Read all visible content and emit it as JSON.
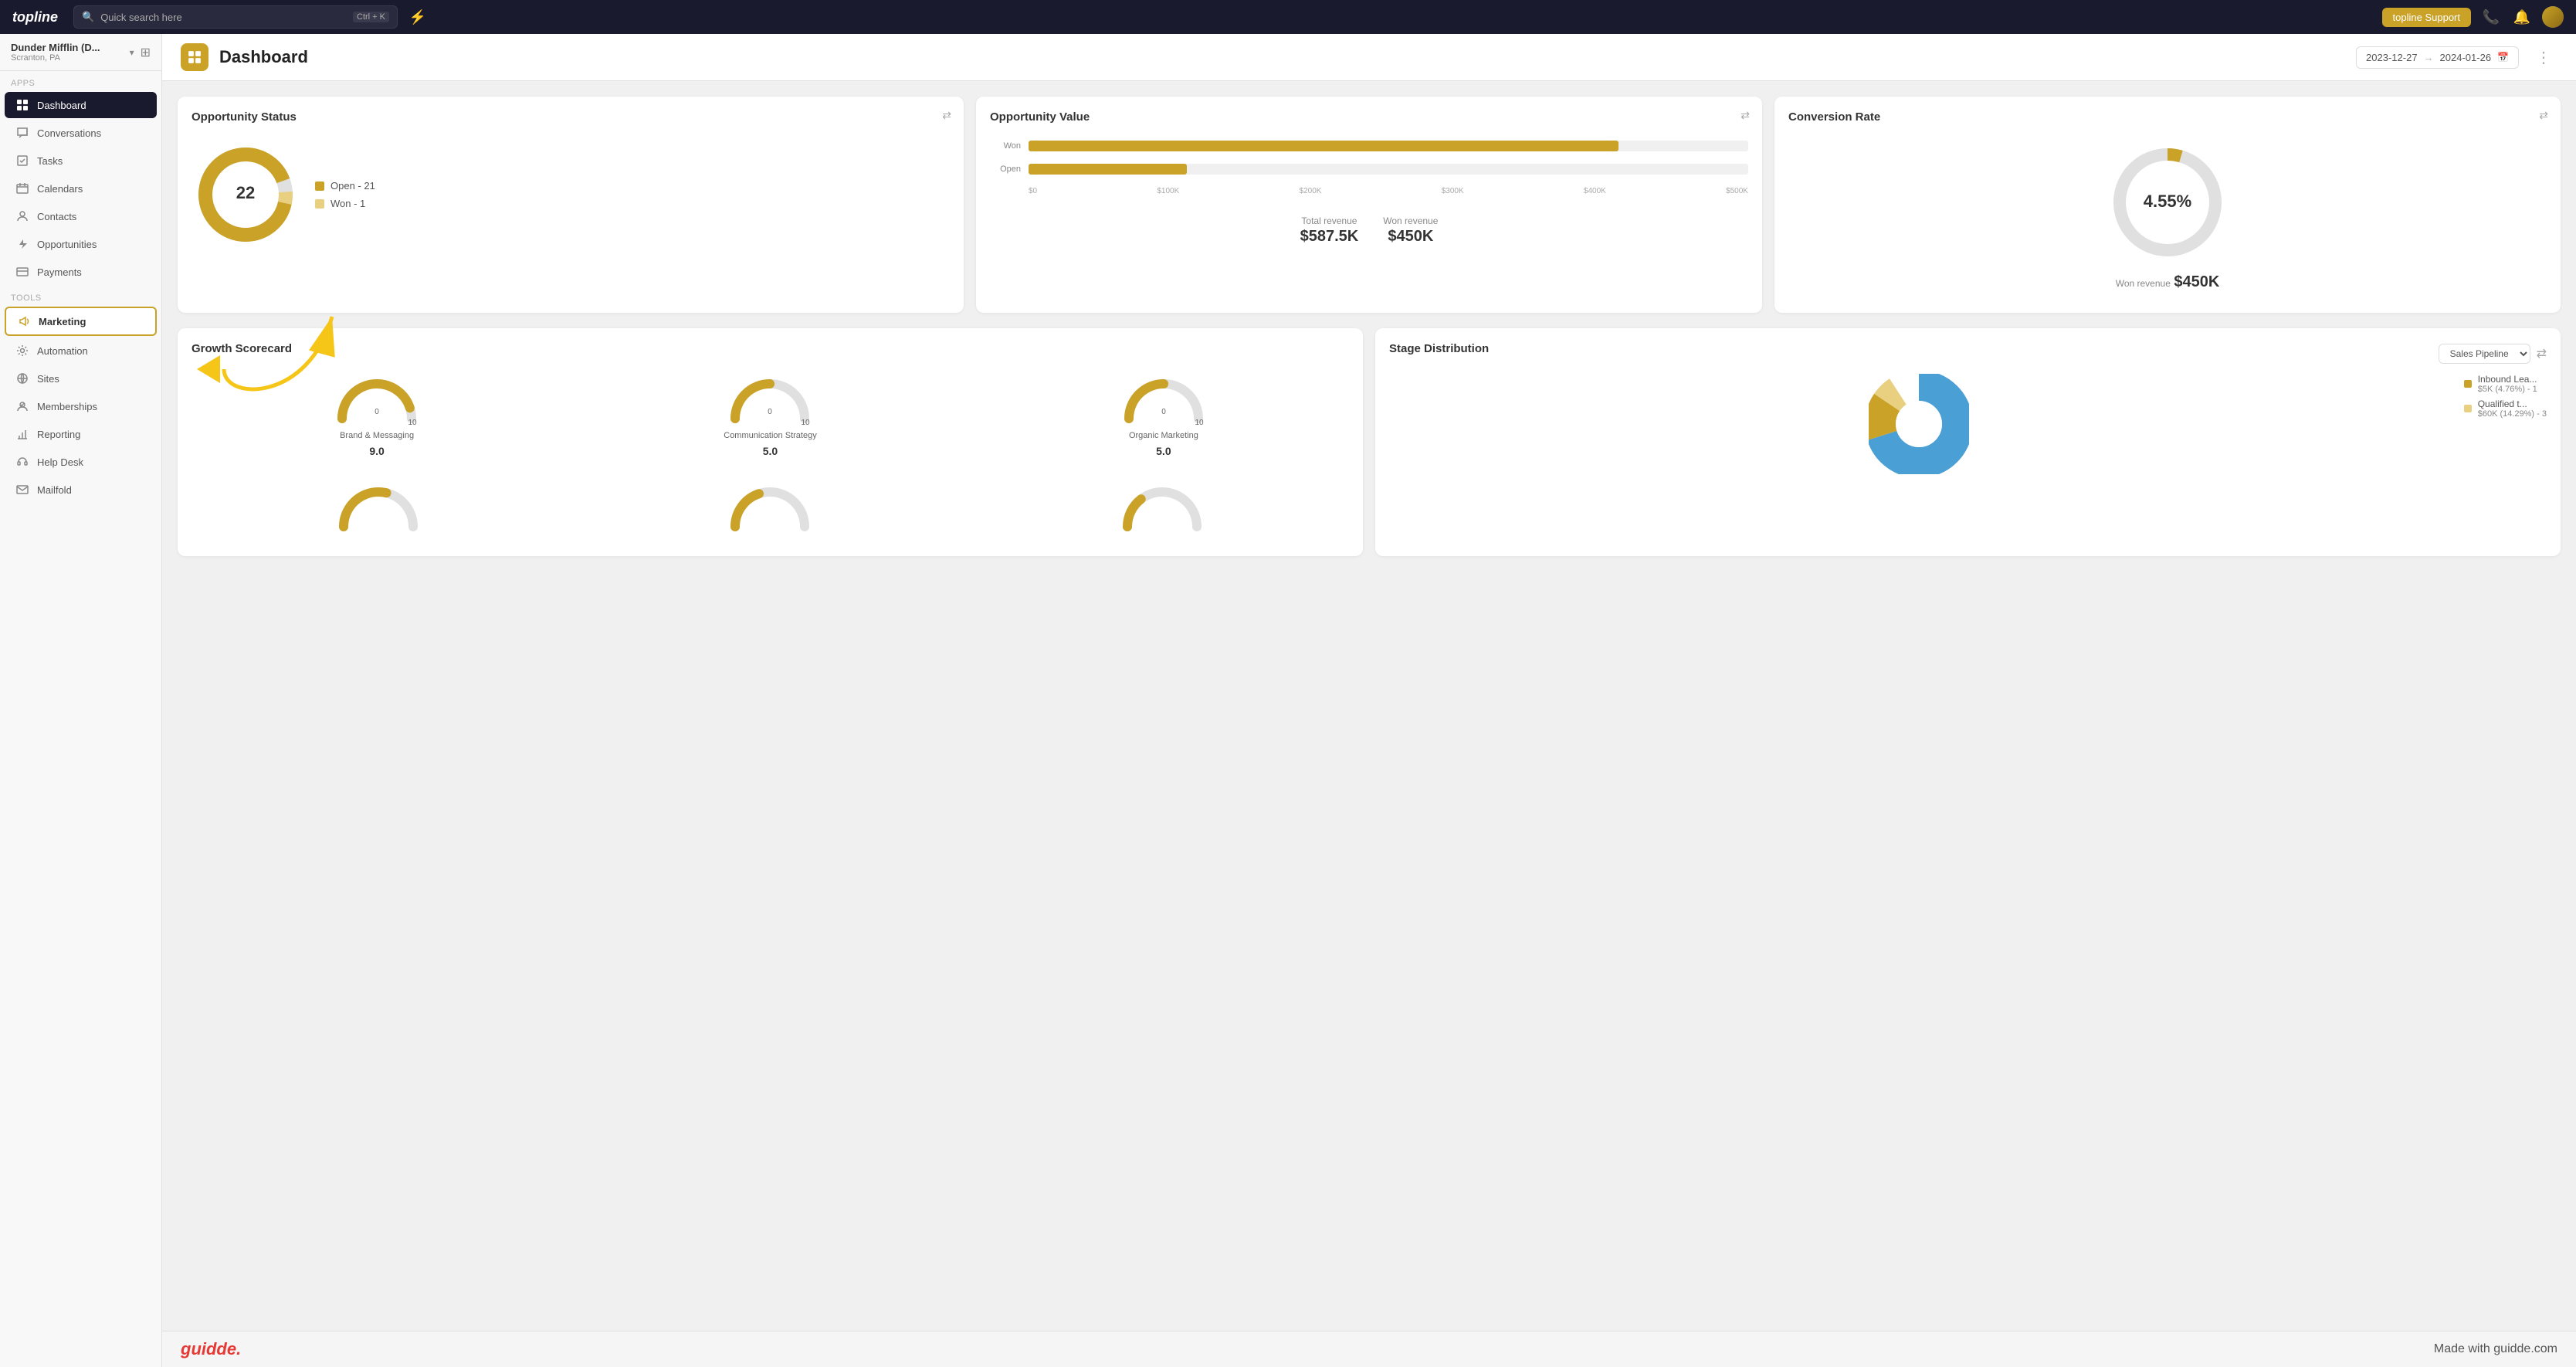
{
  "app": {
    "logo": "topline",
    "support_btn": "topline Support"
  },
  "search": {
    "placeholder": "Quick search here",
    "shortcut": "Ctrl + K"
  },
  "workspace": {
    "name": "Dunder Mifflin (D...",
    "location": "Scranton, PA"
  },
  "sidebar": {
    "apps_label": "Apps",
    "tools_label": "Tools",
    "items": [
      {
        "id": "dashboard",
        "label": "Dashboard",
        "icon": "grid",
        "active": true
      },
      {
        "id": "conversations",
        "label": "Conversations",
        "icon": "chat"
      },
      {
        "id": "tasks",
        "label": "Tasks",
        "icon": "checklist"
      },
      {
        "id": "calendars",
        "label": "Calendars",
        "icon": "calendar"
      },
      {
        "id": "contacts",
        "label": "Contacts",
        "icon": "person"
      },
      {
        "id": "opportunities",
        "label": "Opportunities",
        "icon": "lightning"
      },
      {
        "id": "payments",
        "label": "Payments",
        "icon": "card"
      },
      {
        "id": "marketing",
        "label": "Marketing",
        "icon": "megaphone",
        "highlighted": true
      },
      {
        "id": "automation",
        "label": "Automation",
        "icon": "gear"
      },
      {
        "id": "sites",
        "label": "Sites",
        "icon": "globe"
      },
      {
        "id": "memberships",
        "label": "Memberships",
        "icon": "membership"
      },
      {
        "id": "reporting",
        "label": "Reporting",
        "icon": "chart"
      },
      {
        "id": "helpdesk",
        "label": "Help Desk",
        "icon": "headset"
      },
      {
        "id": "mailfold",
        "label": "Mailfold",
        "icon": "mail"
      }
    ]
  },
  "header": {
    "title": "Dashboard",
    "date_start": "2023-12-27",
    "date_end": "2024-01-26"
  },
  "cards": {
    "opportunity_status": {
      "title": "Opportunity Status",
      "total": "22",
      "legend": [
        {
          "label": "Open - 21",
          "color": "#c9a227"
        },
        {
          "label": "Won - 1",
          "color": "#e8d080"
        }
      ],
      "donut": {
        "open_pct": 95.5,
        "won_pct": 4.5
      }
    },
    "opportunity_value": {
      "title": "Opportunity Value",
      "bars": [
        {
          "label": "Won",
          "pct": 82
        },
        {
          "label": "Open",
          "pct": 22
        }
      ],
      "xaxis": [
        "$0",
        "$100K",
        "$200K",
        "$300K",
        "$400K",
        "$500K"
      ],
      "total_revenue_label": "Total revenue",
      "total_revenue": "$587.5K",
      "won_revenue_label": "Won revenue",
      "won_revenue": "$450K"
    },
    "conversion_rate": {
      "title": "Conversion Rate",
      "value": "4.55%",
      "won_revenue_label": "Won revenue",
      "won_revenue": "$450K"
    },
    "growth_scorecard": {
      "title": "Growth Scorecard",
      "items": [
        {
          "label": "Brand & Messaging",
          "value": "9.0",
          "pct": 90
        },
        {
          "label": "Communication Strategy",
          "value": "5.0",
          "pct": 50
        },
        {
          "label": "Organic Marketing",
          "value": "5.0",
          "pct": 50
        }
      ]
    },
    "stage_distribution": {
      "title": "Stage Distribution",
      "select_label": "Sales Pipeline",
      "legend": [
        {
          "label": "Inbound Lea...",
          "sub": "$5K (4.76%) - 1",
          "color": "#c9a227"
        },
        {
          "label": "Qualified t...",
          "sub": "$60K (14.29%) - 3",
          "color": "#e8d080"
        }
      ]
    }
  },
  "bottom": {
    "logo": "guidde.",
    "tagline": "Made with guidde.com"
  }
}
